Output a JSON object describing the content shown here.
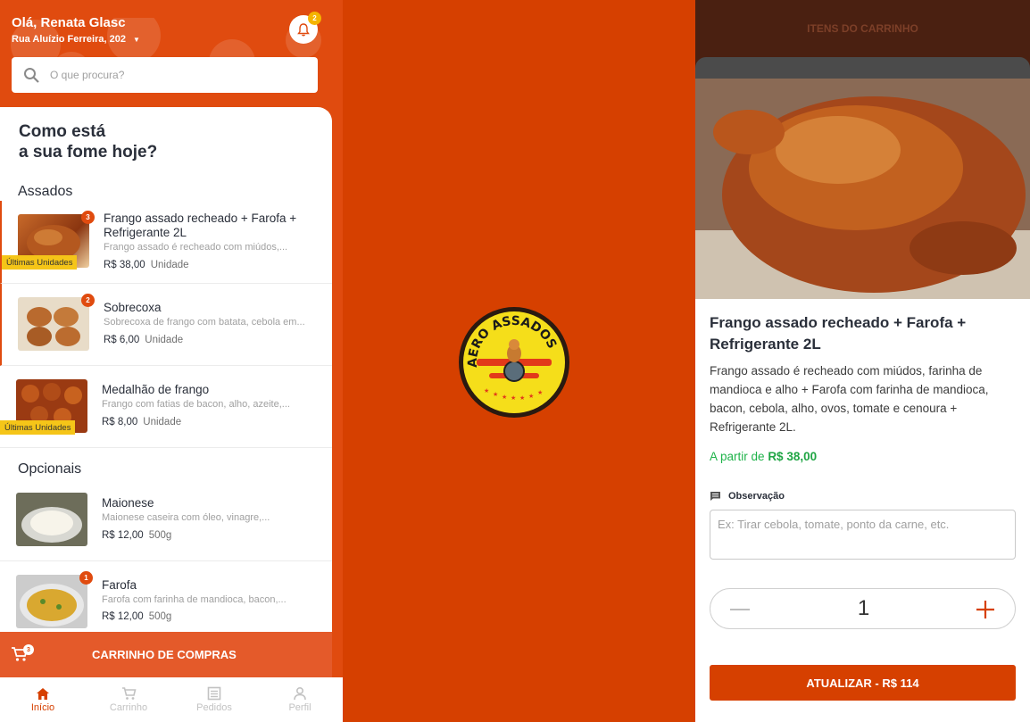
{
  "header": {
    "greeting": "Olá, Renata Glasc",
    "address": "Rua Aluízio Ferreira, 202",
    "notifications_count": "2"
  },
  "search": {
    "placeholder": "O que procura?"
  },
  "hero": {
    "title_line1": "Como está",
    "title_line2": "a sua fome hoje?"
  },
  "sections": [
    {
      "title": "Assados",
      "items": [
        {
          "name": "Frango assado recheado + Farofa + Refrigerante 2L",
          "desc": "Frango assado é recheado com miúdos,...",
          "price": "R$ 38,00",
          "unit": "Unidade",
          "badge": "3",
          "tag": "Últimas Unidades"
        },
        {
          "name": "Sobrecoxa",
          "desc": "Sobrecoxa de frango com batata, cebola em...",
          "price": "R$ 6,00",
          "unit": "Unidade",
          "badge": "2",
          "tag": ""
        },
        {
          "name": "Medalhão de frango",
          "desc": "Frango com fatias de bacon, alho, azeite,...",
          "price": "R$ 8,00",
          "unit": "Unidade",
          "badge": "",
          "tag": "Últimas Unidades"
        }
      ]
    },
    {
      "title": "Opcionais",
      "items": [
        {
          "name": "Maionese",
          "desc": "Maionese caseira com óleo, vinagre,...",
          "price": "R$ 12,00",
          "unit": "500g",
          "badge": "",
          "tag": ""
        },
        {
          "name": "Farofa",
          "desc": "Farofa com farinha de mandioca, bacon,...",
          "price": "R$ 12,00",
          "unit": "500g",
          "badge": "1",
          "tag": ""
        }
      ]
    }
  ],
  "cart_bar": {
    "label": "CARRINHO DE COMPRAS",
    "count": "3"
  },
  "bottom_nav": [
    {
      "label": "Início",
      "icon": "home-icon",
      "active": true
    },
    {
      "label": "Carrinho",
      "icon": "cart-icon",
      "active": false
    },
    {
      "label": "Pedidos",
      "icon": "orders-icon",
      "active": false
    },
    {
      "label": "Perfil",
      "icon": "profile-icon",
      "active": false
    }
  ],
  "logo": {
    "text": "AERO ASSADOS"
  },
  "detail": {
    "header_title": "ITENS DO CARRINHO",
    "title": "Frango assado recheado + Farofa + Refrigerante 2L",
    "description": "Frango assado é recheado com miúdos, farinha de mandioca e alho + Farofa com farinha de mandioca, bacon, cebola, alho, ovos, tomate e cenoura + Refrigerante 2L.",
    "price_prefix": "A partir de",
    "price": "R$ 38,00",
    "observation_label": "Observação",
    "observation_placeholder": "Ex: Tirar cebola, tomate, ponto da carne, etc.",
    "quantity": "1",
    "update_button": "ATUALIZAR - R$ 114"
  },
  "colors": {
    "brand": "#d64000",
    "accent": "#e04b0f",
    "badge_yellow": "#f5c518",
    "price_green": "#1fa544"
  }
}
